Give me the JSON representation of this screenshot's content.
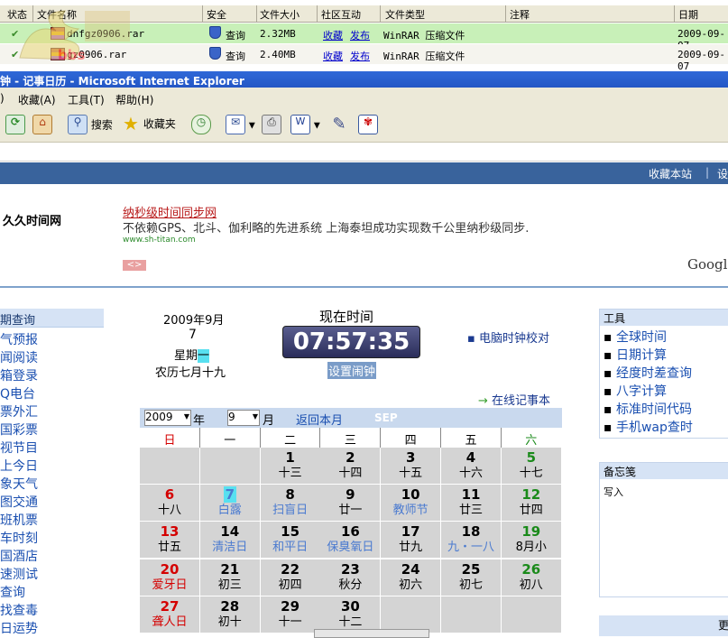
{
  "downloads": {
    "columns": [
      "状态",
      "文件名称",
      "安全",
      "文件大小",
      "社区互动",
      "文件类型",
      "注释",
      "日期"
    ],
    "rows": [
      {
        "name": "dnfgz0906.rar",
        "security": "查询",
        "size": "2.32MB",
        "collect": "收藏",
        "publish": "发布",
        "type": "WinRAR 压缩文件",
        "date": "2009-09-07"
      },
      {
        "name": "gz0906.rar",
        "security": "查询",
        "size": "2.40MB",
        "collect": "收藏",
        "publish": "发布",
        "type": "WinRAR 压缩文件",
        "date": "2009-09-07"
      }
    ],
    "watermark": "bbs"
  },
  "window": {
    "title": "钟 - 记事日历 - Microsoft Internet Explorer"
  },
  "menu": [
    "收藏(A)",
    "工具(T)",
    "帮助(H)"
  ],
  "toolbar": {
    "search": "搜索",
    "favorites": "收藏夹"
  },
  "page": {
    "top_links": [
      "收藏本站",
      "设"
    ],
    "site_name": "久久时间网",
    "ad": {
      "title": "纳秒级时间同步网",
      "text": "不依赖GPS、北斗、伽利略的先进系统 上海泰坦成功实现数千公里纳秒级同步.",
      "url": "www.sh-titan.com",
      "arrows": "<>"
    },
    "google": "Google"
  },
  "left_nav": {
    "heading": "期查询",
    "items": [
      "气预报",
      "闻阅读",
      "箱登录",
      "Q电台",
      "票外汇",
      "国彩票",
      "视节目",
      "上今日",
      "象天气",
      "图交通",
      "班机票",
      "车时刻",
      "国酒店",
      "速测试",
      "查询",
      "找查毒",
      "日运势"
    ]
  },
  "date_panel": {
    "ym": "2009年9月",
    "day": "7",
    "weekday_prefix": "星期",
    "weekday": "一",
    "lunar": "农历七月十九"
  },
  "clock": {
    "title": "现在时间",
    "time": "07:57:35",
    "alarm": "设置闹钟",
    "sync": "电脑时钟校对",
    "notebook": "在线记事本"
  },
  "tools": {
    "heading": "工具",
    "items": [
      "全球时间",
      "日期计算",
      "经度时差查询",
      "八字计算",
      "标准时间代码",
      "手机wap查时"
    ]
  },
  "memo": {
    "heading": "备忘笺",
    "text": "写入",
    "footer": "更"
  },
  "calendar": {
    "year": "2009",
    "year_suffix": "年",
    "month": "9",
    "month_suffix": "月",
    "back": "返回本月",
    "abbr": "SEP",
    "weekdays": [
      "日",
      "一",
      "二",
      "三",
      "四",
      "五",
      "六"
    ],
    "cells": [
      {
        "n": "",
        "l": "",
        "c": "",
        "col": 0,
        "row": 0
      },
      {
        "n": "",
        "l": "",
        "c": "",
        "col": 1,
        "row": 0
      },
      {
        "n": "1",
        "l": "十三",
        "c": "",
        "col": 2,
        "row": 0
      },
      {
        "n": "2",
        "l": "十四",
        "c": "",
        "col": 3,
        "row": 0
      },
      {
        "n": "3",
        "l": "十五",
        "c": "",
        "col": 4,
        "row": 0
      },
      {
        "n": "4",
        "l": "十六",
        "c": "",
        "col": 5,
        "row": 0
      },
      {
        "n": "5",
        "l": "十七",
        "c": "sat",
        "col": 6,
        "row": 0
      },
      {
        "n": "6",
        "l": "十八",
        "c": "sun",
        "col": 0,
        "row": 1
      },
      {
        "n": "7",
        "l": "白露",
        "c": "today",
        "col": 1,
        "row": 1
      },
      {
        "n": "8",
        "l": "扫盲日",
        "c": "",
        "col": 2,
        "row": 1
      },
      {
        "n": "9",
        "l": "廿一",
        "c": "",
        "col": 3,
        "row": 1
      },
      {
        "n": "10",
        "l": "教师节",
        "c": "",
        "col": 4,
        "row": 1
      },
      {
        "n": "11",
        "l": "廿三",
        "c": "",
        "col": 5,
        "row": 1
      },
      {
        "n": "12",
        "l": "廿四",
        "c": "sat",
        "col": 6,
        "row": 1
      },
      {
        "n": "13",
        "l": "廿五",
        "c": "sun",
        "col": 0,
        "row": 2
      },
      {
        "n": "14",
        "l": "清洁日",
        "c": "",
        "col": 1,
        "row": 2
      },
      {
        "n": "15",
        "l": "和平日",
        "c": "",
        "col": 2,
        "row": 2
      },
      {
        "n": "16",
        "l": "保臭氧日",
        "c": "",
        "col": 3,
        "row": 2
      },
      {
        "n": "17",
        "l": "廿九",
        "c": "",
        "col": 4,
        "row": 2
      },
      {
        "n": "18",
        "l": "九・一八",
        "c": "",
        "col": 5,
        "row": 2
      },
      {
        "n": "19",
        "l": "8月小",
        "c": "sat",
        "col": 6,
        "row": 2
      },
      {
        "n": "20",
        "l": "爱牙日",
        "c": "sun",
        "col": 0,
        "row": 3
      },
      {
        "n": "21",
        "l": "初三",
        "c": "",
        "col": 1,
        "row": 3
      },
      {
        "n": "22",
        "l": "初四",
        "c": "",
        "col": 2,
        "row": 3
      },
      {
        "n": "23",
        "l": "秋分",
        "c": "",
        "col": 3,
        "row": 3
      },
      {
        "n": "24",
        "l": "初六",
        "c": "",
        "col": 4,
        "row": 3
      },
      {
        "n": "25",
        "l": "初七",
        "c": "",
        "col": 5,
        "row": 3
      },
      {
        "n": "26",
        "l": "初八",
        "c": "sat",
        "col": 6,
        "row": 3
      },
      {
        "n": "27",
        "l": "聋人日",
        "c": "sun",
        "col": 0,
        "row": 4
      },
      {
        "n": "28",
        "l": "初十",
        "c": "",
        "col": 1,
        "row": 4
      },
      {
        "n": "29",
        "l": "十一",
        "c": "",
        "col": 2,
        "row": 4
      },
      {
        "n": "30",
        "l": "十二",
        "c": "",
        "col": 3,
        "row": 4
      },
      {
        "n": "",
        "l": "",
        "c": "",
        "col": 4,
        "row": 4
      },
      {
        "n": "",
        "l": "",
        "c": "",
        "col": 5,
        "row": 4
      },
      {
        "n": "",
        "l": "",
        "c": "",
        "col": 6,
        "row": 4
      }
    ]
  },
  "colors": {
    "sun": "#d40000",
    "sat": "#1a8a1a",
    "festival": "#4a7ad0",
    "link": "#1a4fb0"
  }
}
